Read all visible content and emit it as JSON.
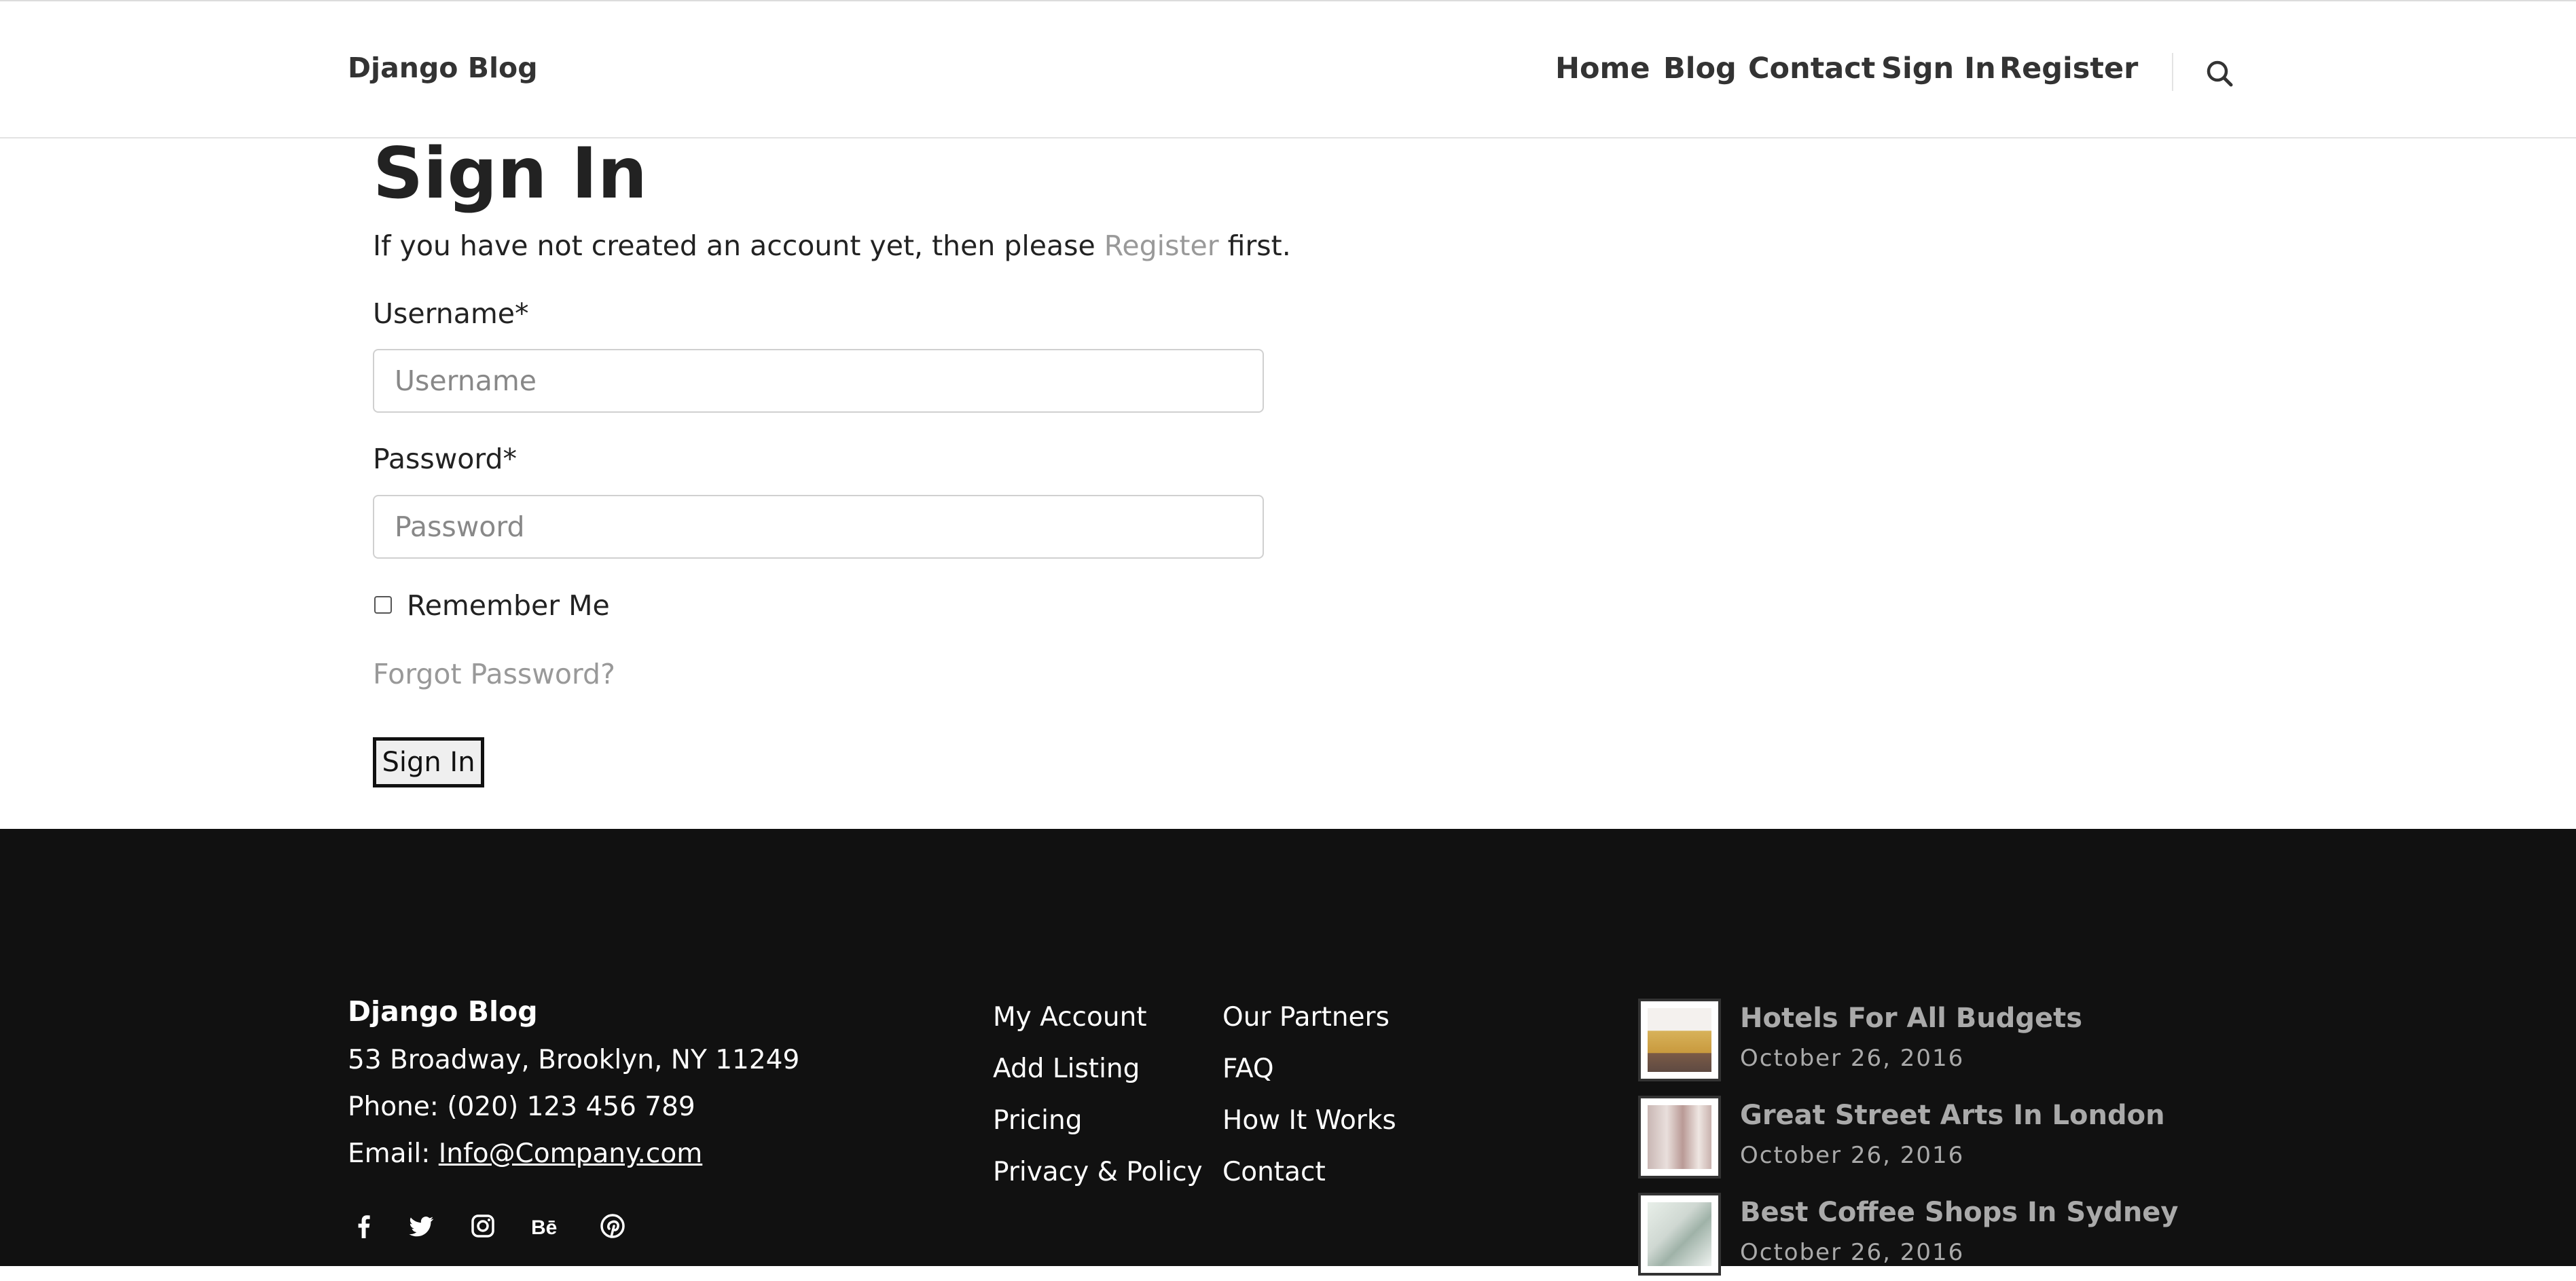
{
  "header": {
    "brand": "Django Blog",
    "nav": [
      "Home",
      "Blog",
      "Contact",
      "Sign In",
      "Register"
    ]
  },
  "main": {
    "title": "Sign In",
    "intro_before": "If you have not created an account yet, then please ",
    "intro_link": "Register",
    "intro_after": " first.",
    "username_label": "Username*",
    "username_placeholder": "Username",
    "username_value": "",
    "password_label": "Password*",
    "password_placeholder": "Password",
    "password_value": "",
    "remember_label": "Remember Me",
    "remember_checked": false,
    "forgot_label": "Forgot Password?",
    "submit_label": "Sign In"
  },
  "footer": {
    "brand": "Django Blog",
    "address": "53 Broadway, Brooklyn, NY 11249",
    "phone": "Phone: (020) 123 456 789",
    "email_label": "Email: ",
    "email": "Info@Company.com",
    "social": [
      "facebook-icon",
      "twitter-icon",
      "instagram-icon",
      "behance-icon",
      "pinterest-icon"
    ],
    "links_col1": [
      "My Account",
      "Add Listing",
      "Pricing",
      "Privacy & Policy"
    ],
    "links_col2": [
      "Our Partners",
      "FAQ",
      "How It Works",
      "Contact"
    ],
    "posts": [
      {
        "title": "Hotels For All Budgets",
        "date": "October 26, 2016"
      },
      {
        "title": "Great Street Arts In London",
        "date": "October 26, 2016"
      },
      {
        "title": "Best Coffee Shops In Sydney",
        "date": "October 26, 2016"
      }
    ]
  }
}
